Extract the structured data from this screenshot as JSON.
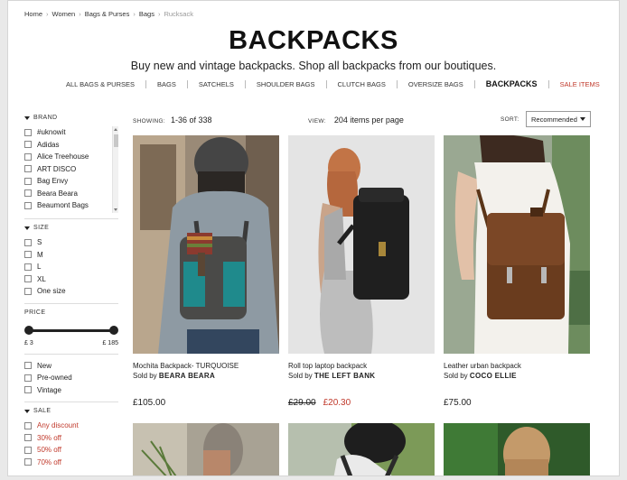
{
  "breadcrumbs": [
    "Home",
    "Women",
    "Bags & Purses",
    "Bags",
    "Rucksack"
  ],
  "page": {
    "title": "BACKPACKS",
    "subtitle": "Buy new and vintage backpacks. Shop all backpacks from our boutiques."
  },
  "nav": [
    "ALL BAGS & PURSES",
    "BAGS",
    "SATCHELS",
    "SHOULDER BAGS",
    "CLUTCH BAGS",
    "OVERSIZE BAGS",
    "BACKPACKS",
    "SALE ITEMS"
  ],
  "filters": {
    "brand": {
      "label": "BRAND",
      "options": [
        "#uknowit",
        "Adidas",
        "Alice Treehouse",
        "ART DISCO",
        "Bag Envy",
        "Beara Beara",
        "Beaumont Bags"
      ]
    },
    "size": {
      "label": "SIZE",
      "options": [
        "S",
        "M",
        "L",
        "XL",
        "One size"
      ]
    },
    "price": {
      "label": "PRICE",
      "min": "£ 3",
      "max": "£ 185"
    },
    "condition": [
      "New",
      "Pre-owned",
      "Vintage"
    ],
    "sale": {
      "label": "SALE",
      "options": [
        "Any discount",
        "30% off",
        "50% off",
        "70% off"
      ]
    }
  },
  "toolbar": {
    "showing_label": "SHOWING:",
    "showing_value": "1-36 of 338",
    "view_label": "VIEW:",
    "view_value": "204 items per page",
    "sort_label": "SORT:",
    "sort_value": "Recommended"
  },
  "products": [
    {
      "name": "Mochita Backpack- TURQUOISE",
      "sold_prefix": "Sold by",
      "seller": "BEARA BEARA",
      "price": "£105.00"
    },
    {
      "name": "Roll top laptop backpack",
      "sold_prefix": "Sold by",
      "seller": "THE LEFT BANK",
      "old_price": "£29.00",
      "sale_price": "£20.30"
    },
    {
      "name": "Leather urban backpack",
      "sold_prefix": "Sold by",
      "seller": "COCO ELLIE",
      "price": "£75.00"
    }
  ],
  "colors": {
    "sale": "#c0392b",
    "text": "#222222"
  }
}
